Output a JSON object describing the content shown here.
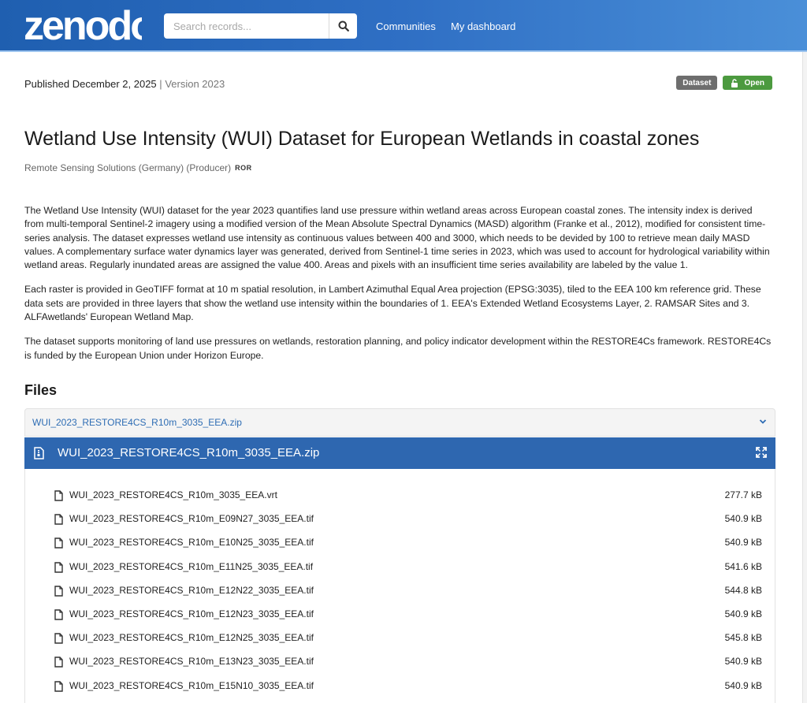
{
  "header": {
    "logo_text": "zenodo",
    "search": {
      "placeholder": "Search records..."
    },
    "nav": {
      "communities": "Communities",
      "dashboard": "My dashboard"
    },
    "icons": {
      "search": "search-icon"
    }
  },
  "record": {
    "published": "Published December 2, 2025",
    "separator": "|",
    "version": "Version 2023",
    "badges": {
      "type": "Dataset",
      "access": "Open"
    },
    "title": "Wetland Use Intensity (WUI) Dataset for European Wetlands in coastal zones",
    "creator": "Remote Sensing Solutions (Germany) (Producer)",
    "ror_label": "ROR",
    "description": [
      "The Wetland Use Intensity (WUI) dataset for the year 2023 quantifies land use pressure within wetland areas across European coastal zones. The intensity index is derived from multi-temporal Sentinel-2 imagery using a modified version of the Mean Absolute Spectral Dynamics (MASD) algorithm (Franke et al., 2012), modified for consistent time-series analysis. The dataset expresses wetland use intensity as continuous values between 400 and 3000, which needs to be devided by 100 to retrieve mean daily MASD values. A complementary surface water dynamics layer was generated, derived from Sentinel-1 time series in 2023, which was used to account for hydrological variability within wetland areas. Regularly inundated areas are assigned the value 400. Areas and pixels with an insufficient time series availability are labeled by the value 1.",
      "Each raster is provided in GeoTIFF format at 10 m spatial resolution, in Lambert Azimuthal Equal Area projection (EPSG:3035), tiled to the EEA 100 km reference grid. These data sets are provided in three layers that show the wetland use intensity within the boundaries of 1. EEA's Extended Wetland Ecosystems Layer, 2. RAMSAR Sites and 3. ALFAwetlands' European Wetland Map.",
      "The dataset supports monitoring of land use pressures on wetlands, restoration planning, and policy indicator development within the RESTORE4Cs framework. RESTORE4Cs is funded by the European Union under Horizon Europe."
    ]
  },
  "files": {
    "heading": "Files",
    "archive_name": "WUI_2023_RESTORE4CS_R10m_3035_EEA.zip",
    "preview_title": "WUI_2023_RESTORE4CS_R10m_3035_EEA.zip",
    "items": [
      {
        "name": "WUI_2023_RESTORE4CS_R10m_3035_EEA.vrt",
        "size": "277.7 kB"
      },
      {
        "name": "WUI_2023_RESTORE4CS_R10m_E09N27_3035_EEA.tif",
        "size": "540.9 kB"
      },
      {
        "name": "WUI_2023_RESTORE4CS_R10m_E10N25_3035_EEA.tif",
        "size": "540.9 kB"
      },
      {
        "name": "WUI_2023_RESTORE4CS_R10m_E11N25_3035_EEA.tif",
        "size": "541.6 kB"
      },
      {
        "name": "WUI_2023_RESTORE4CS_R10m_E12N22_3035_EEA.tif",
        "size": "544.8 kB"
      },
      {
        "name": "WUI_2023_RESTORE4CS_R10m_E12N23_3035_EEA.tif",
        "size": "540.9 kB"
      },
      {
        "name": "WUI_2023_RESTORE4CS_R10m_E12N25_3035_EEA.tif",
        "size": "545.8 kB"
      },
      {
        "name": "WUI_2023_RESTORE4CS_R10m_E13N23_3035_EEA.tif",
        "size": "540.9 kB"
      },
      {
        "name": "WUI_2023_RESTORE4CS_R10m_E15N10_3035_EEA.tif",
        "size": "540.9 kB"
      }
    ]
  },
  "colors": {
    "header": "#2f6fc4",
    "link": "#2e6db4",
    "open_badge": "#4c9a3f",
    "dataset_badge": "#6e6e6e",
    "file_bar": "#2e67b0"
  }
}
